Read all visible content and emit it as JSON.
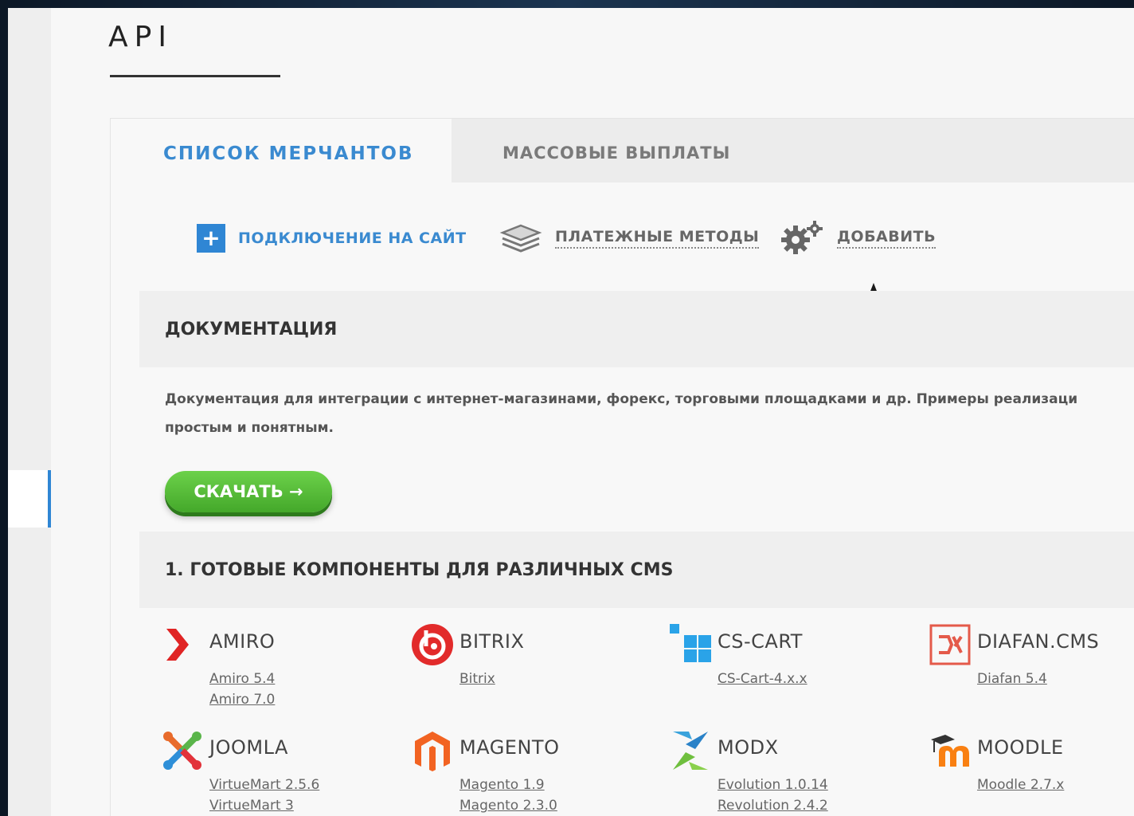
{
  "page": {
    "title": "API"
  },
  "tabs": [
    {
      "label": "СПИСОК МЕРЧАНТОВ",
      "active": true
    },
    {
      "label": "МАССОВЫЕ ВЫПЛАТЫ",
      "active": false
    }
  ],
  "actions": {
    "connect": "ПОДКЛЮЧЕНИЕ НА САЙТ",
    "methods": "ПЛАТЕЖНЫЕ МЕТОДЫ",
    "add": "ДОБАВИТЬ"
  },
  "docs": {
    "title": "ДОКУМЕНТАЦИЯ",
    "line1": "Документация для интеграции с интернет-магазинами, форекс, торговыми площадками и др. Примеры реализаци",
    "line2": "простым и понятным.",
    "download": "СКАЧАТЬ →"
  },
  "cms_section": {
    "title": "1. ГОТОВЫЕ КОМПОНЕНТЫ ДЛЯ РАЗЛИЧНЫХ CMS"
  },
  "cms": [
    {
      "name": "AMIRO",
      "icon": "amiro-logo",
      "links": [
        "Amiro 5.4",
        "Amiro 7.0"
      ]
    },
    {
      "name": "BITRIX",
      "icon": "bitrix-logo",
      "links": [
        "Bitrix"
      ]
    },
    {
      "name": "CS-CART",
      "icon": "cscart-logo",
      "links": [
        "CS-Cart-4.x.x"
      ]
    },
    {
      "name": "DIAFAN.CMS",
      "icon": "diafan-logo",
      "links": [
        "Diafan 5.4"
      ]
    },
    {
      "name": "JOOMLA",
      "icon": "joomla-logo",
      "links": [
        "VirtueMart 2.5.6",
        "VirtueMart 3"
      ]
    },
    {
      "name": "MAGENTO",
      "icon": "magento-logo",
      "links": [
        "Magento 1.9",
        "Magento 2.3.0"
      ]
    },
    {
      "name": "MODX",
      "icon": "modx-logo",
      "links": [
        "Evolution 1.0.14",
        "Revolution 2.4.2"
      ]
    },
    {
      "name": "MOODLE",
      "icon": "moodle-logo",
      "links": [
        "Moodle 2.7.x"
      ]
    }
  ],
  "colors": {
    "accent": "#3a8ad0",
    "button": "#4fb834",
    "background": "#f7f7f7"
  }
}
